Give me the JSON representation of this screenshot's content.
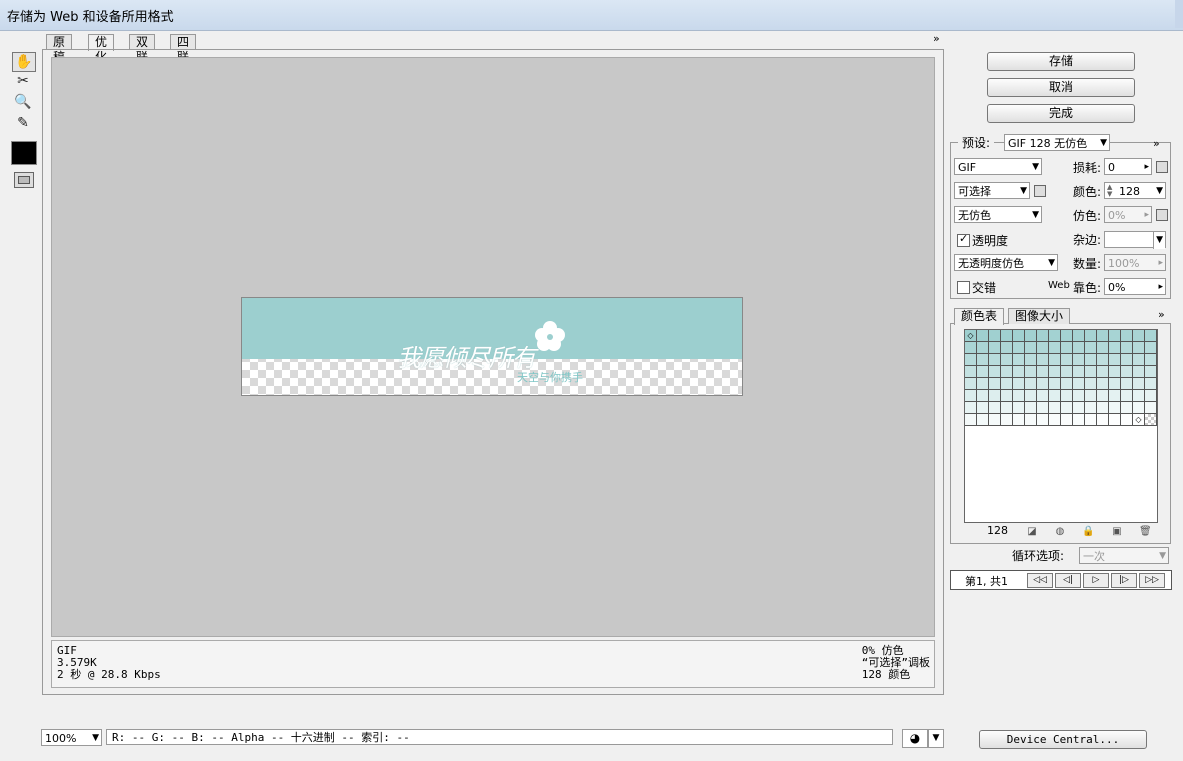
{
  "window": {
    "title": "存储为 Web 和设备所用格式"
  },
  "tools": [
    {
      "icon": "hand-icon",
      "glyph": "✋"
    },
    {
      "icon": "slice-select-icon",
      "glyph": "✂"
    },
    {
      "icon": "zoom-icon",
      "glyph": "🔍"
    },
    {
      "icon": "eyedropper-icon",
      "glyph": "✎"
    }
  ],
  "tabs": [
    "原稿",
    "优化",
    "双联",
    "四联"
  ],
  "preview": {
    "slogan": "我愿倾尽所有",
    "subtitle": "天空与你携手"
  },
  "info": {
    "format": "GIF",
    "size": "3.579K",
    "speed": "2 秒 @ 28.8 Kbps",
    "dither": "0% 仿色",
    "palette": "“可选择”调板",
    "colors": "128 颜色"
  },
  "buttons": {
    "save": "存储",
    "cancel": "取消",
    "done": "完成",
    "device_central": "Device Central..."
  },
  "settings": {
    "preset_label": "预设:",
    "preset_value": "GIF 128 无仿色",
    "format": "GIF",
    "reduction": "可选择",
    "dither_algo": "无仿色",
    "transparency_label": "透明度",
    "transparency_checked": true,
    "trans_dither": "无透明度仿色",
    "interlaced_label": "交错",
    "interlaced_checked": false,
    "lossy_label": "损耗:",
    "lossy_value": "0",
    "colors_label": "颜色:",
    "colors_value": "128",
    "dither_label": "仿色:",
    "dither_value": "0%",
    "matte_label": "杂边:",
    "amount_label": "数量:",
    "amount_value": "100%",
    "web_label": "Web",
    "websnap_label": "靠色:",
    "websnap_value": "0%"
  },
  "panel_tabs": [
    "颜色表",
    "图像大小"
  ],
  "color_table": {
    "count": "128"
  },
  "loop": {
    "label": "循环选项:",
    "value": "一次"
  },
  "animation": {
    "frame_label": "第1, 共1"
  },
  "zoom": "100%",
  "status": "R: -- G: -- B: -- Alpha -- 十六进制    -- 索引: --"
}
